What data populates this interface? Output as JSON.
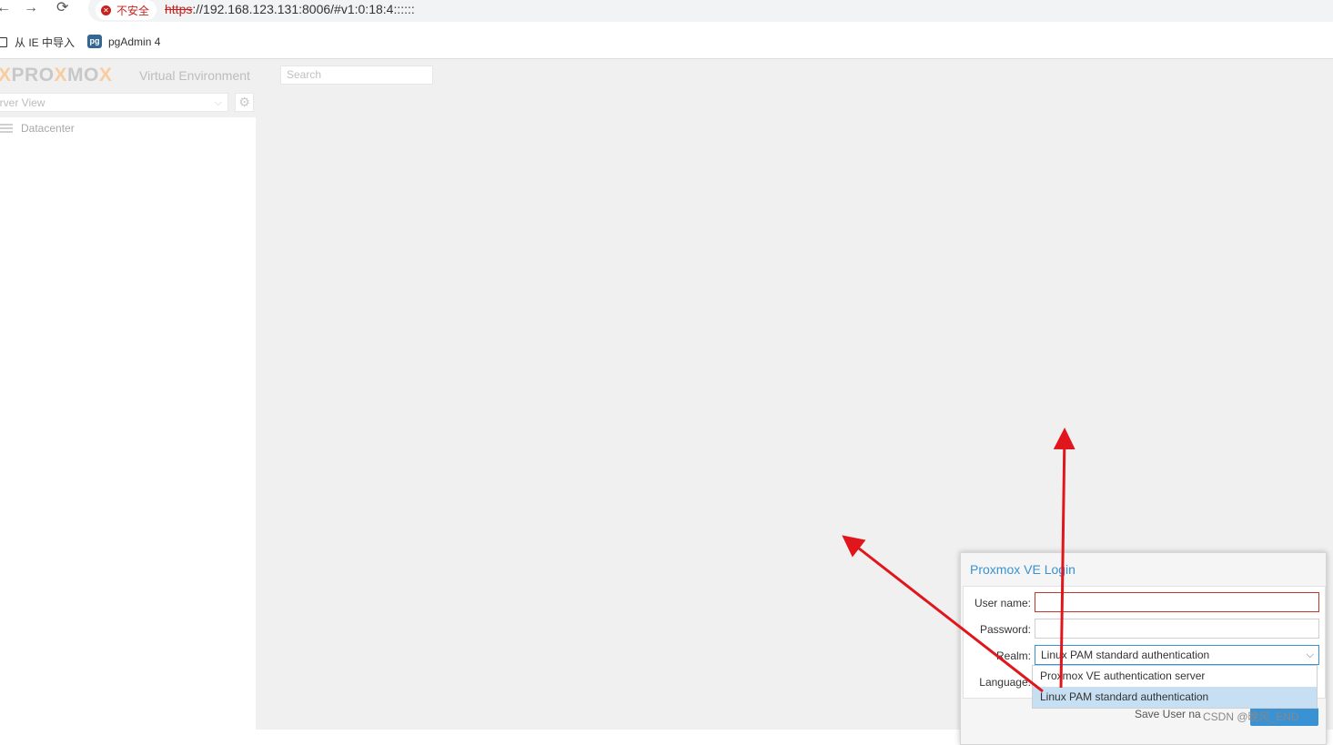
{
  "browser": {
    "back_glyph": "←",
    "forward_glyph": "→",
    "reload_glyph": "⟳",
    "security_label": "不安全",
    "url_scheme": "https",
    "url_rest": "://192.168.123.131:8006/#v1:0:18:4::::::",
    "bookmarks": [
      {
        "label": "从 IE 中导入"
      },
      {
        "label": "pgAdmin 4",
        "icon_text": "pg"
      }
    ]
  },
  "app": {
    "logo_left": "PRO",
    "logo_x1": "X",
    "logo_mid": "MO",
    "logo_x2": "X",
    "logo_subtitle": "Virtual Environment",
    "search_placeholder": "Search",
    "view_selector": "erver View",
    "tree": [
      {
        "label": "Datacenter"
      }
    ]
  },
  "login": {
    "title": "Proxmox VE Login",
    "username_label": "User name:",
    "password_label": "Password:",
    "realm_label": "Realm:",
    "language_label": "Language:",
    "realm_value": "Linux PAM standard authentication",
    "realm_options": [
      "Proxmox VE authentication server",
      "Linux PAM standard authentication"
    ],
    "selected_option_index": 1,
    "save_user_label": "Save User na",
    "watermark": "CSDN @晚风_END"
  },
  "colors": {
    "accent": "#3892d4",
    "error": "#c0392b",
    "annotation_arrow": "#e0161c"
  }
}
